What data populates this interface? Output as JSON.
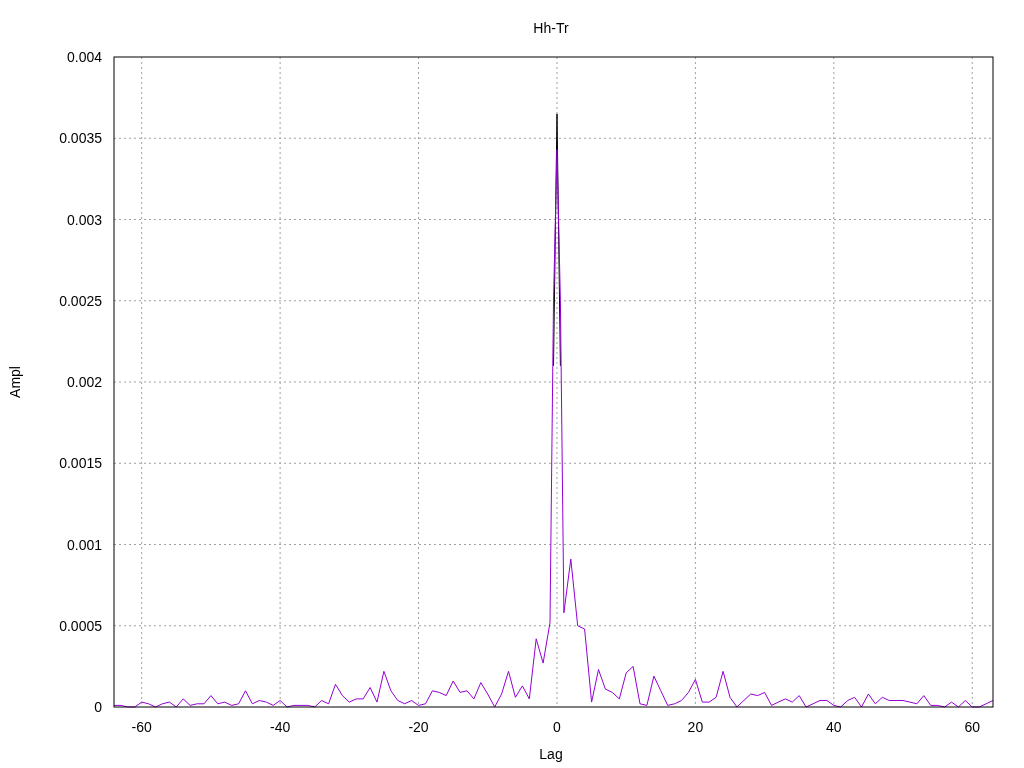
{
  "chart_data": {
    "type": "line",
    "grid": true,
    "title": "Hh-Tr",
    "xlabel": "Lag",
    "ylabel": "Ampl",
    "xlim": [
      -64,
      63
    ],
    "ylim": [
      0,
      0.004
    ],
    "xticks": [
      -60,
      -40,
      -20,
      0,
      20,
      40,
      60
    ],
    "yticks": [
      0,
      0.0005,
      0.001,
      0.0015,
      0.002,
      0.0025,
      0.003,
      0.0035,
      0.004
    ],
    "x": [
      -64,
      -63,
      -62,
      -61,
      -60,
      -59,
      -58,
      -57,
      -56,
      -55,
      -54,
      -53,
      -52,
      -51,
      -50,
      -49,
      -48,
      -47,
      -46,
      -45,
      -44,
      -43,
      -42,
      -41,
      -40,
      -39,
      -38,
      -37,
      -36,
      -35,
      -34,
      -33,
      -32,
      -31,
      -30,
      -29,
      -28,
      -27,
      -26,
      -25,
      -24,
      -23,
      -22,
      -21,
      -20,
      -19,
      -18,
      -17,
      -16,
      -15,
      -14,
      -13,
      -12,
      -11,
      -10,
      -9,
      -8,
      -7,
      -6,
      -5,
      -4,
      -3,
      -2,
      -1,
      -0.5,
      0,
      0.5,
      1,
      2,
      3,
      4,
      5,
      6,
      7,
      8,
      9,
      10,
      11,
      12,
      13,
      14,
      15,
      16,
      17,
      18,
      19,
      20,
      21,
      22,
      23,
      24,
      25,
      26,
      27,
      28,
      29,
      30,
      31,
      32,
      33,
      34,
      35,
      36,
      37,
      38,
      39,
      40,
      41,
      42,
      43,
      44,
      45,
      46,
      47,
      48,
      49,
      50,
      51,
      52,
      53,
      54,
      55,
      56,
      57,
      58,
      59,
      60,
      61,
      62,
      63
    ],
    "series": [
      {
        "color": "#000000",
        "values": [
          null,
          null,
          null,
          null,
          null,
          null,
          null,
          null,
          null,
          null,
          null,
          null,
          null,
          null,
          null,
          null,
          null,
          null,
          null,
          null,
          null,
          null,
          null,
          null,
          null,
          null,
          null,
          null,
          null,
          null,
          null,
          null,
          null,
          null,
          null,
          null,
          null,
          null,
          null,
          null,
          null,
          null,
          null,
          null,
          null,
          null,
          null,
          null,
          null,
          null,
          null,
          null,
          null,
          null,
          null,
          null,
          null,
          null,
          null,
          null,
          null,
          null,
          null,
          null,
          0.0021,
          0.00365,
          0.0021,
          null,
          null,
          null,
          null,
          null,
          null,
          null,
          null,
          null,
          null,
          null,
          null,
          null,
          null,
          null,
          null,
          null,
          null,
          null,
          null,
          null,
          null,
          null,
          null,
          null,
          null,
          null,
          null,
          null,
          null,
          null,
          null,
          null,
          null,
          null,
          null,
          null,
          null,
          null,
          null,
          null,
          null,
          null,
          null,
          null,
          null,
          null,
          null,
          null,
          null,
          null,
          null,
          null,
          null,
          null,
          null,
          null,
          null,
          null,
          null,
          null,
          null,
          null
        ]
      },
      {
        "color": "#9400d3",
        "values": [
          1e-05,
          1e-05,
          0,
          0,
          3e-05,
          2e-05,
          0,
          2e-05,
          3e-05,
          0,
          5e-05,
          1e-05,
          2e-05,
          2e-05,
          7e-05,
          2e-05,
          3e-05,
          1e-05,
          2e-05,
          0.0001,
          2e-05,
          4e-05,
          3e-05,
          1e-05,
          4e-05,
          0,
          1e-05,
          1e-05,
          1e-05,
          0,
          4e-05,
          2e-05,
          0.00014,
          7e-05,
          3e-05,
          5e-05,
          5e-05,
          0.00012,
          3e-05,
          0.00022,
          0.0001,
          4e-05,
          2e-05,
          4e-05,
          1e-05,
          2e-05,
          0.0001,
          9e-05,
          7e-05,
          0.00016,
          9e-05,
          0.0001,
          5e-05,
          0.00015,
          8e-05,
          0,
          8e-05,
          0.00022,
          6e-05,
          0.00013,
          5e-05,
          0.00042,
          0.00027,
          0.00052,
          0.0025,
          0.00343,
          0.0025,
          0.00058,
          0.00091,
          0.0005,
          0.00048,
          3e-05,
          0.00023,
          0.00011,
          9e-05,
          5e-05,
          0.00021,
          0.00025,
          2e-05,
          1e-05,
          0.00019,
          0.0001,
          1e-05,
          2e-05,
          4e-05,
          9e-05,
          0.00017,
          3e-05,
          3e-05,
          6e-05,
          0.00022,
          6e-05,
          0,
          4e-05,
          8e-05,
          7e-05,
          9e-05,
          1e-05,
          3e-05,
          5e-05,
          3e-05,
          7e-05,
          0,
          2e-05,
          4e-05,
          4e-05,
          1e-05,
          0,
          4e-05,
          6e-05,
          0,
          8e-05,
          2e-05,
          6e-05,
          4e-05,
          4e-05,
          4e-05,
          3e-05,
          2e-05,
          7e-05,
          1e-05,
          1e-05,
          0,
          3e-05,
          0,
          4e-05,
          0,
          0,
          2e-05,
          4e-05
        ]
      }
    ]
  }
}
